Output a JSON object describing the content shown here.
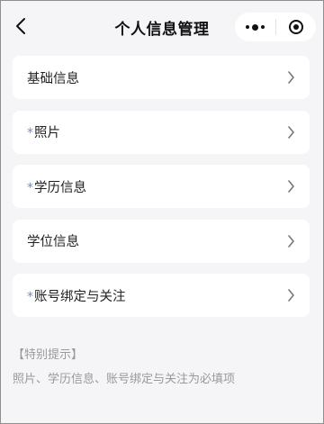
{
  "header": {
    "title": "个人信息管理",
    "back_icon": "chevron-left-icon",
    "more_icon": "more-dots-icon",
    "close_icon": "target-circle-icon"
  },
  "menu": {
    "items": [
      {
        "label": "基础信息",
        "required": false
      },
      {
        "label": "照片",
        "required": true
      },
      {
        "label": "学历信息",
        "required": true
      },
      {
        "label": "学位信息",
        "required": false
      },
      {
        "label": "账号绑定与关注",
        "required": true
      }
    ],
    "required_mark": "*",
    "chevron_icon": "chevron-right-icon"
  },
  "notice": {
    "title": "【特别提示】",
    "body": "照片、学历信息、账号绑定与关注为必填项"
  },
  "colors": {
    "background": "#f5f5f7",
    "card": "#ffffff",
    "required_mark": "#7a8cb5",
    "hint_text": "#999999"
  }
}
